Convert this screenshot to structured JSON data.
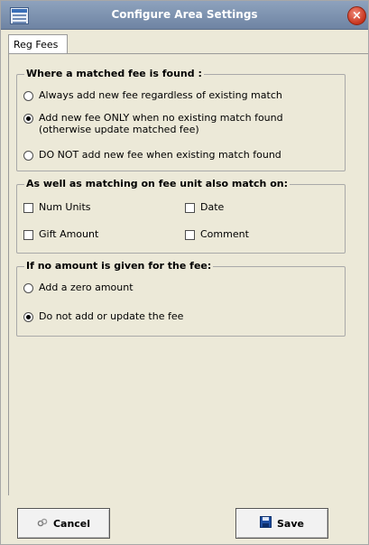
{
  "window": {
    "title": "Configure Area Settings"
  },
  "tabs": [
    {
      "label": "Reg Fees",
      "active": true
    }
  ],
  "match_group": {
    "legend": "Where a matched fee is found :",
    "options": [
      {
        "label": "Always add new fee regardless of existing match",
        "selected": false
      },
      {
        "label_line1": "Add new fee ONLY when no existing match found",
        "label_line2": "(otherwise update matched fee)",
        "selected": true
      },
      {
        "label": "DO NOT add new fee when existing match found",
        "selected": false
      }
    ]
  },
  "also_match_group": {
    "legend": "As well as matching on fee unit also match on:",
    "options": [
      {
        "label": "Num Units",
        "checked": false
      },
      {
        "label": "Date",
        "checked": false
      },
      {
        "label": "Gift Amount",
        "checked": false
      },
      {
        "label": "Comment",
        "checked": false
      }
    ]
  },
  "no_amount_group": {
    "legend": "If no amount is given for the fee:",
    "options": [
      {
        "label": "Add a zero amount",
        "selected": false
      },
      {
        "label": "Do not add or update the fee",
        "selected": true
      }
    ]
  },
  "buttons": {
    "cancel": "Cancel",
    "save": "Save"
  },
  "icons": {
    "window": "table-icon",
    "close": "close-icon",
    "cancel": "link-icon",
    "save": "floppy-disk-icon"
  }
}
